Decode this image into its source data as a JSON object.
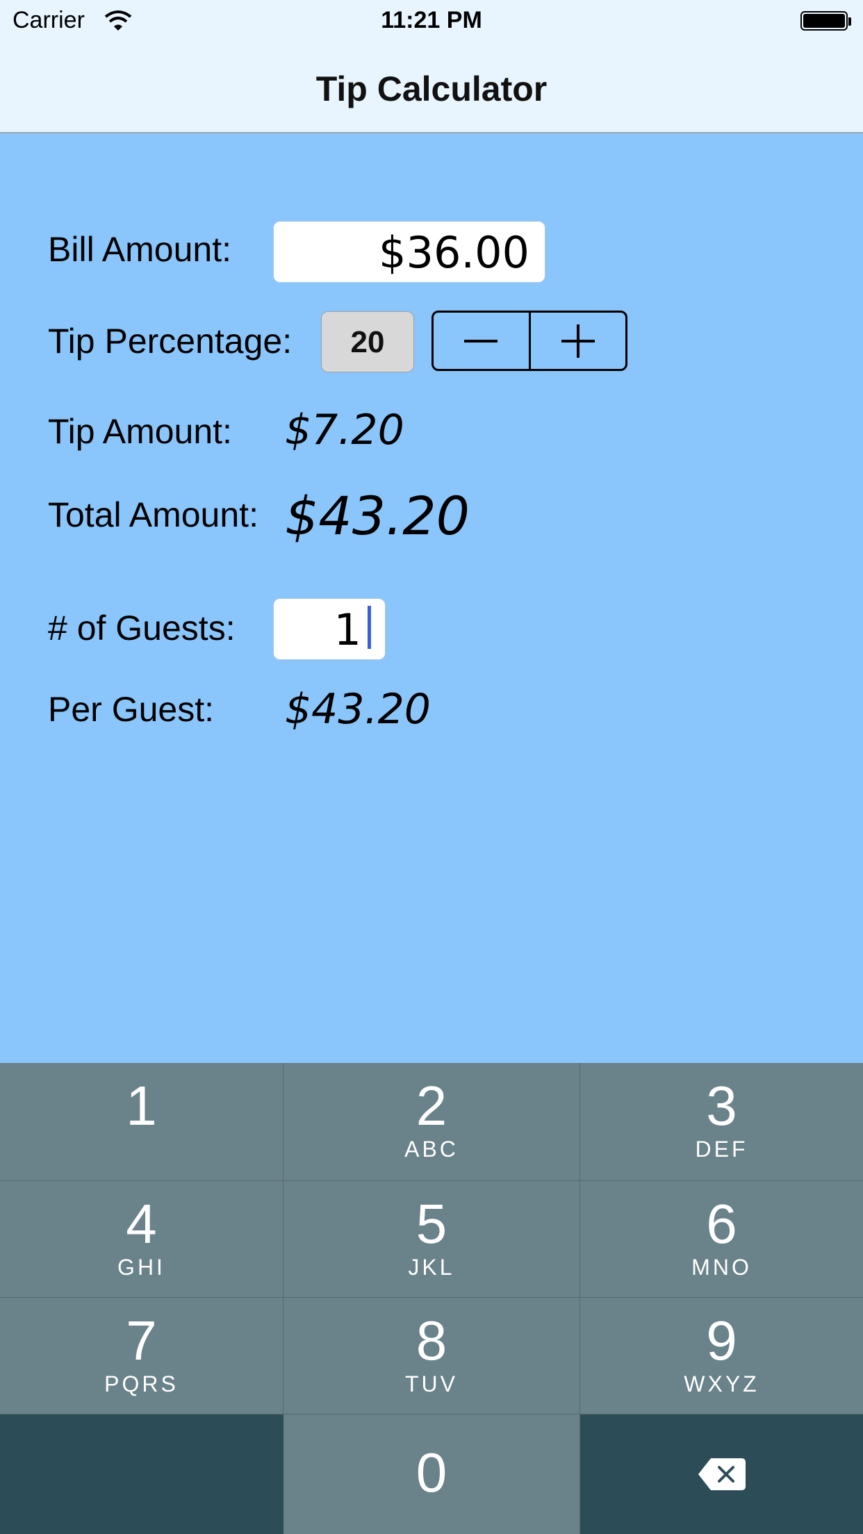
{
  "status_bar": {
    "carrier": "Carrier",
    "time": "11:21 PM"
  },
  "nav": {
    "title": "Tip Calculator"
  },
  "form": {
    "bill_label": "Bill Amount:",
    "bill_value": "$36.00",
    "tip_pct_label": "Tip Percentage:",
    "tip_pct_value": "20",
    "tip_amount_label": "Tip Amount:",
    "tip_amount_value": "$7.20",
    "total_label": "Total Amount:",
    "total_value": "$43.20",
    "guests_label": "# of Guests:",
    "guests_value": "1",
    "per_guest_label": "Per Guest:",
    "per_guest_value": "$43.20"
  },
  "keypad": {
    "keys": [
      {
        "digit": "1",
        "letters": ""
      },
      {
        "digit": "2",
        "letters": "ABC"
      },
      {
        "digit": "3",
        "letters": "DEF"
      },
      {
        "digit": "4",
        "letters": "GHI"
      },
      {
        "digit": "5",
        "letters": "JKL"
      },
      {
        "digit": "6",
        "letters": "MNO"
      },
      {
        "digit": "7",
        "letters": "PQRS"
      },
      {
        "digit": "8",
        "letters": "TUV"
      },
      {
        "digit": "9",
        "letters": "WXYZ"
      },
      {
        "digit": "0",
        "letters": ""
      }
    ]
  },
  "colors": {
    "background": "#8ac6fc",
    "bar": "#e8f4fe",
    "keyboard": "#6a8289",
    "keyboard_dark": "#2c4d58",
    "cursor": "#3c5fe0"
  }
}
